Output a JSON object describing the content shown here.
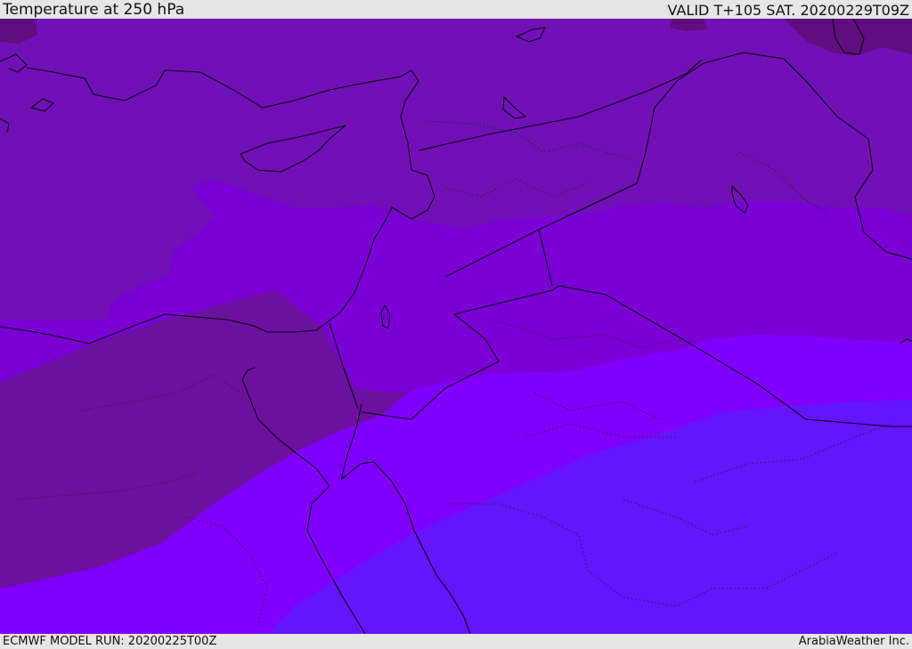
{
  "header": {
    "title": "Temperature at 250 hPa",
    "valid": "VALID T+105 SAT. 20200229T09Z"
  },
  "footer": {
    "model_run": "ECMWF MODEL RUN: 20200225T00Z",
    "credit": "ArabiaWeather Inc."
  },
  "colors": {
    "band_coldest": "#5f0d7f",
    "band_1": "#6c10a0",
    "band_2": "#7210b8",
    "band_3": "#7a00d6",
    "band_4": "#8000ff",
    "band_warmest": "#6515ff",
    "coastline": "#000000"
  }
}
